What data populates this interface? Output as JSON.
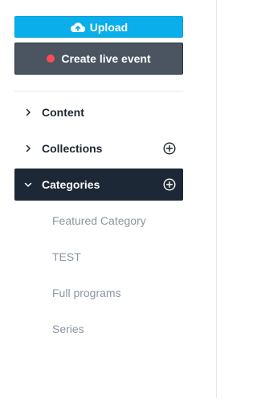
{
  "actions": {
    "upload_label": "Upload",
    "live_label": "Create live event"
  },
  "nav": {
    "items": [
      {
        "label": "Content"
      },
      {
        "label": "Collections"
      },
      {
        "label": "Categories"
      }
    ],
    "categories": [
      {
        "label": "Featured Category"
      },
      {
        "label": "TEST"
      },
      {
        "label": "Full programs"
      },
      {
        "label": "Series"
      }
    ]
  },
  "icons": {
    "upload": "cloud-upload-icon",
    "live": "live-dot-icon",
    "collapsed": "chevron-right-icon",
    "expanded": "chevron-down-icon",
    "add": "plus-circle-icon"
  },
  "colors": {
    "upload_bg": "#0aaeea",
    "live_bg": "#4a5561",
    "live_dot": "#ff4b55",
    "active_bg": "#1d2836",
    "text_dark": "#1d2731",
    "text_muted": "#8a96a3"
  }
}
